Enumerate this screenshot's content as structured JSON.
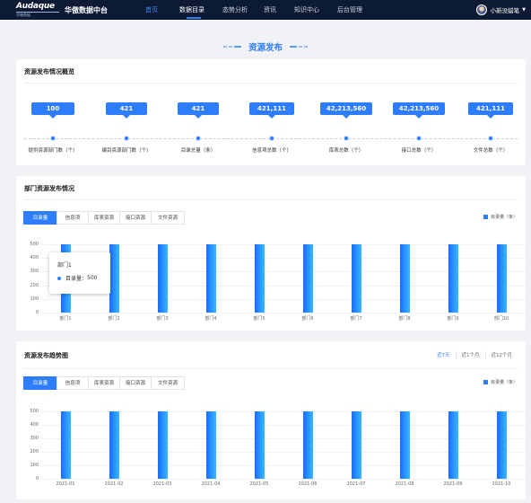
{
  "app": {
    "logo_text": "Audaque",
    "logo_sub": "华傲数据",
    "title": "华傲数据中台"
  },
  "nav": [
    {
      "label": "首页"
    },
    {
      "label": "数据目录"
    },
    {
      "label": "态势分析"
    },
    {
      "label": "资讯"
    },
    {
      "label": "知识中心"
    },
    {
      "label": "后台管理"
    }
  ],
  "user": {
    "name": "小新没蜡笔"
  },
  "page_title": "资源发布",
  "overview": {
    "title": "资源发布情况概览",
    "items": [
      {
        "value": "100",
        "label": "提供资源部门数（个）"
      },
      {
        "value": "421",
        "label": "编目资源部门数（个）"
      },
      {
        "value": "421",
        "label": "目录总量（条）"
      },
      {
        "value": "421,111",
        "label": "信息项总数（个）"
      },
      {
        "value": "42,213,560",
        "label": "库表总数（个）"
      },
      {
        "value": "42,213,560",
        "label": "接口总数（个）"
      },
      {
        "value": "421,111",
        "label": "文件总数（个）"
      }
    ]
  },
  "dept": {
    "title": "部门资源发布情况",
    "tabs": [
      "目录量",
      "信息项",
      "库表资源",
      "接口资源",
      "文件资源"
    ],
    "legend": "目录量（条）",
    "tooltip": {
      "title": "部门1",
      "series": "目录量",
      "value": "500"
    }
  },
  "trend": {
    "title": "资源发布趋势图",
    "ranges": [
      "近7天",
      "近1个月",
      "近12个月"
    ],
    "tabs": [
      "目录量",
      "信息项",
      "库表资源",
      "接口资源",
      "文件资源"
    ],
    "legend": "目录量（条）"
  },
  "colors": {
    "accent": "#2f7dff",
    "nav_bg": "#0d1a33"
  },
  "chart_data": [
    {
      "type": "bar",
      "categories": [
        "部门1",
        "部门2",
        "部门3",
        "部门4",
        "部门5",
        "部门6",
        "部门7",
        "部门8",
        "部门9",
        "部门10"
      ],
      "series": [
        {
          "name": "目录量（条）",
          "values": [
            500,
            500,
            500,
            500,
            500,
            500,
            500,
            500,
            500,
            500
          ]
        }
      ],
      "ylim": [
        0,
        500
      ],
      "yticks": [
        0,
        100,
        200,
        300,
        400,
        500
      ],
      "grid": true,
      "legend": "top-right"
    },
    {
      "type": "bar",
      "categories": [
        "2021-01",
        "2021-02",
        "2021-03",
        "2021-04",
        "2021-05",
        "2021-06",
        "2021-07",
        "2021-08",
        "2021-09",
        "2021-10"
      ],
      "series": [
        {
          "name": "目录量（条）",
          "values": [
            500,
            500,
            500,
            500,
            500,
            500,
            500,
            500,
            500,
            500
          ]
        }
      ],
      "ylim": [
        0,
        500
      ],
      "yticks": [
        0,
        100,
        200,
        300,
        400,
        500
      ],
      "grid": true,
      "legend": "top-right"
    }
  ]
}
